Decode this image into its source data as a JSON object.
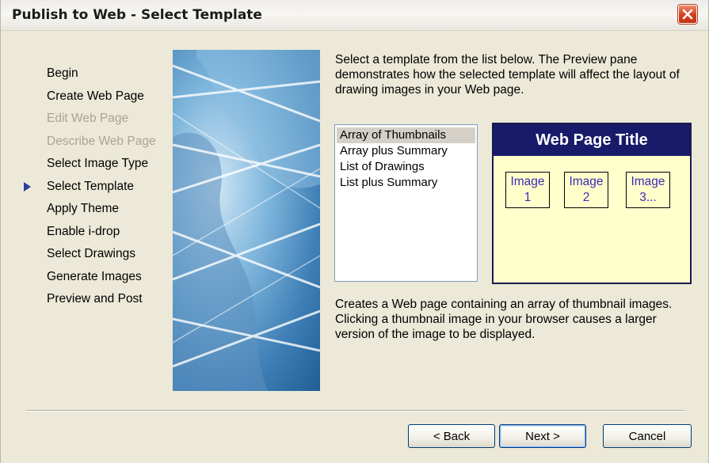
{
  "window": {
    "title": "Publish to Web - Select Template",
    "close_icon": "close-icon"
  },
  "colors": {
    "preview_header": "#181a6a",
    "preview_background": "#ffffcc",
    "thumbnail_text": "#3a2bb5",
    "step_arrow": "#2f3fa0",
    "disabled_text": "#a8a595"
  },
  "steps": [
    {
      "label": "Begin",
      "state": "normal"
    },
    {
      "label": "Create Web Page",
      "state": "normal"
    },
    {
      "label": "Edit Web Page",
      "state": "disabled"
    },
    {
      "label": "Describe Web Page",
      "state": "disabled"
    },
    {
      "label": "Select Image Type",
      "state": "normal"
    },
    {
      "label": "Select Template",
      "state": "current"
    },
    {
      "label": "Apply Theme",
      "state": "normal"
    },
    {
      "label": "Enable i-drop",
      "state": "normal"
    },
    {
      "label": "Select Drawings",
      "state": "normal"
    },
    {
      "label": "Generate Images",
      "state": "normal"
    },
    {
      "label": "Preview and Post",
      "state": "normal"
    }
  ],
  "intro_text": "Select a template from the list below.  The Preview pane demonstrates how the selected template will affect the layout of drawing images in your Web page.",
  "templates": {
    "items": [
      "Array of Thumbnails",
      "Array plus Summary",
      "List of Drawings",
      "List plus Summary"
    ],
    "selected": "Array of Thumbnails"
  },
  "preview": {
    "title": "Web Page Title",
    "images": [
      {
        "line1": "Image",
        "line2": "1"
      },
      {
        "line1": "Image",
        "line2": "2"
      },
      {
        "line1": "Image",
        "line2": "3..."
      }
    ]
  },
  "description": "Creates a Web page containing an array of thumbnail images. Clicking a thumbnail image in your browser causes a larger version of the image to be displayed.",
  "buttons": {
    "back": "< Back",
    "next": "Next >",
    "cancel": "Cancel"
  }
}
